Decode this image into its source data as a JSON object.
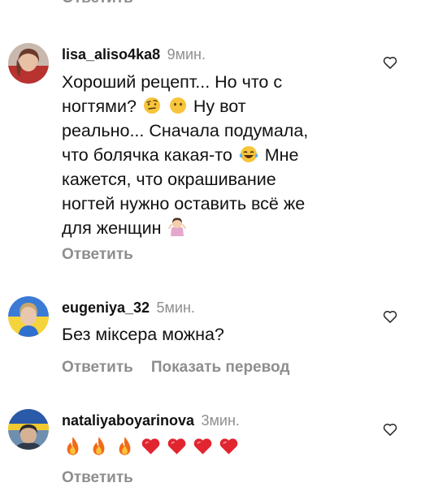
{
  "top_reply_label": "Ответить",
  "comments": [
    {
      "username": "lisa_aliso4ka8",
      "time": "9мин.",
      "lines": [
        "Хороший рецепт... Но что с",
        "ногтями?",
        "реально... Сначала подумала,",
        "что болячка какая-то",
        "кажется, что окрашивание",
        "ногтей нужно оставить всё же",
        "для женщин"
      ],
      "line2_tail": "Ну вот",
      "line4_tail": "Мне",
      "reply_label": "Ответить"
    },
    {
      "username": "eugeniya_32",
      "time": "5мин.",
      "lines": [
        "Без міксера можна?"
      ],
      "reply_label": "Ответить",
      "translate_label": "Показать перевод"
    },
    {
      "username": "nataliyaboyarinova",
      "time": "3мин.",
      "emojis": [
        "fire-emoji",
        "fire-emoji",
        "fire-emoji",
        "red-heart-emoji",
        "red-heart-emoji",
        "red-heart-emoji",
        "red-heart-emoji"
      ],
      "reply_label": "Ответить"
    }
  ],
  "colors": {
    "text": "#111111",
    "muted": "#8e8e8e",
    "background": "#ffffff"
  }
}
